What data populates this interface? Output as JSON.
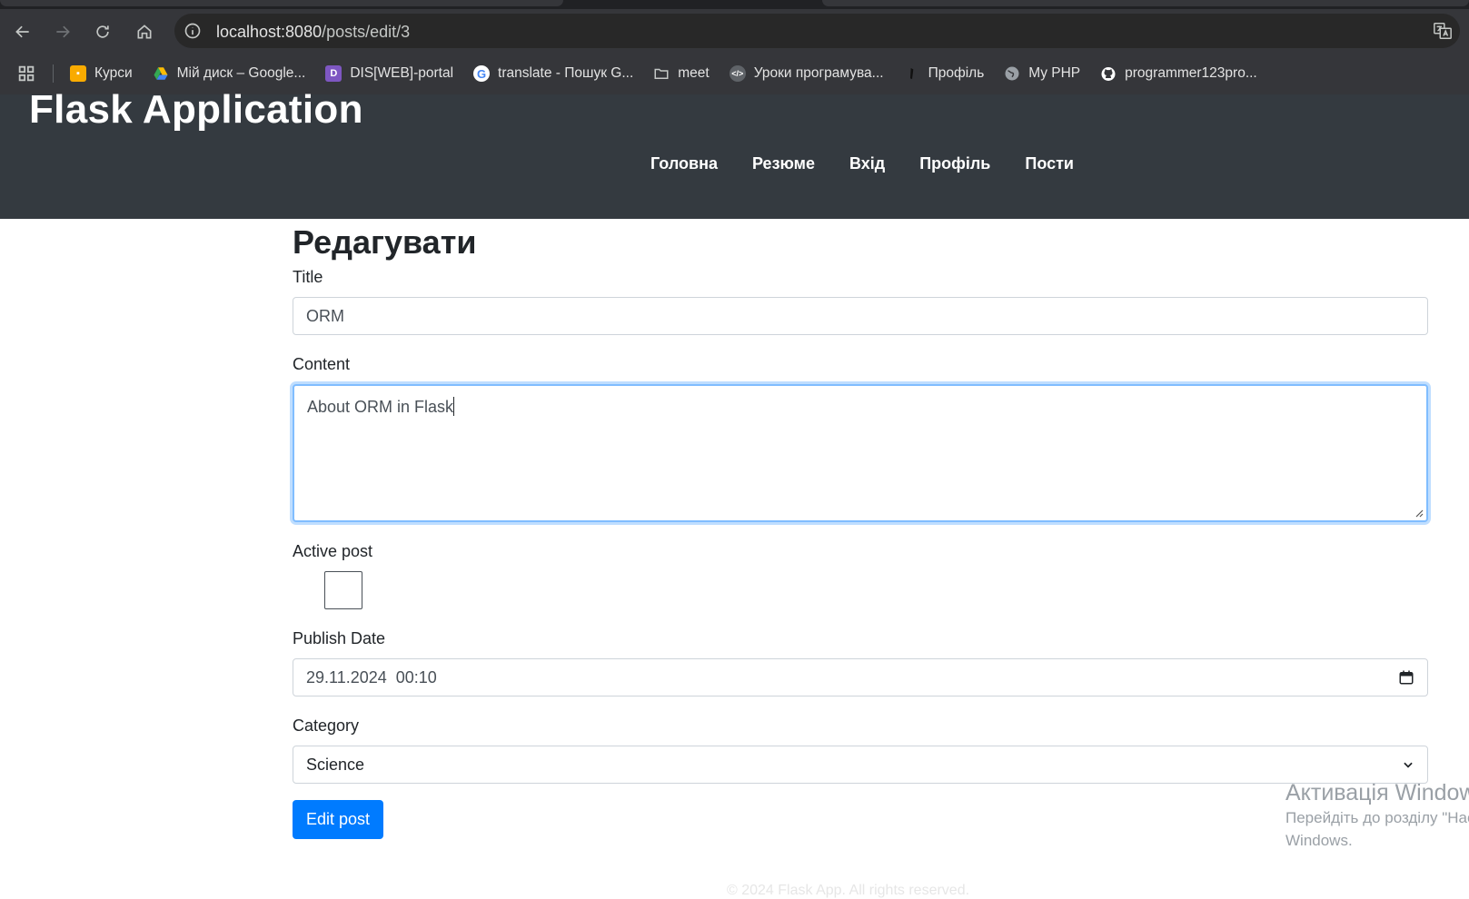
{
  "browser": {
    "url_host": "localhost:8080",
    "url_path": "/posts/edit/3",
    "bookmarks": [
      {
        "label": "Курси",
        "icon": "classroom-icon",
        "color": "#f9ab00"
      },
      {
        "label": "Мій диск – Google...",
        "icon": "google-drive-icon",
        "color": "#34a853"
      },
      {
        "label": "DIS[WEB]-portal",
        "icon": "portal-icon",
        "color": "#7e57c2"
      },
      {
        "label": "translate - Пошук G...",
        "icon": "google-icon",
        "color": "#ffffff"
      },
      {
        "label": "meet",
        "icon": "folder-icon",
        "color": "#c4c7c5"
      },
      {
        "label": "Уроки програмува...",
        "icon": "code-icon",
        "color": "#5f6368"
      },
      {
        "label": "Профіль",
        "icon": "profile-icon",
        "color": "#000000"
      },
      {
        "label": "My PHP",
        "icon": "globe-icon",
        "color": "#9aa0a6"
      },
      {
        "label": "programmer123pro...",
        "icon": "github-icon",
        "color": "#ffffff"
      }
    ]
  },
  "header": {
    "brand": "Flask Application",
    "nav": [
      "Головна",
      "Резюме",
      "Вхід",
      "Профіль",
      "Пости"
    ]
  },
  "form": {
    "title": "Редагувати",
    "title_label": "Title",
    "title_value": "ORM",
    "content_label": "Content",
    "content_value": "About ORM in Flask",
    "active_label": "Active post",
    "active_checked": false,
    "date_label": "Publish Date",
    "date_value": "29.11.2024  00:10",
    "category_label": "Category",
    "category_value": "Science",
    "submit_label": "Edit post"
  },
  "overlay": {
    "activation_title": "Активація Windows",
    "activation_text_1": "Перейдіть до розділу \"Настройки\"",
    "activation_text_2": "Windows."
  },
  "footer": {
    "text": "© 2024 Flask App. All rights reserved."
  },
  "colors": {
    "header_bg": "#343a40",
    "primary": "#007bff",
    "chrome_bg": "#35363a"
  }
}
